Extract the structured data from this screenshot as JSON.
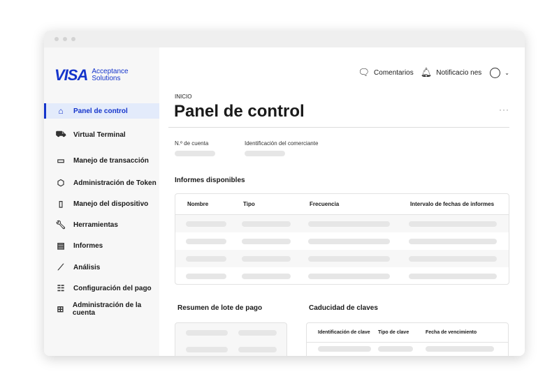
{
  "brand": {
    "logo": "VISA",
    "line1": "Acceptance",
    "line2": "Solutions"
  },
  "sidebar": {
    "items": [
      {
        "label": "Panel de control",
        "icon": "home-icon",
        "active": true
      },
      {
        "label": "Virtual Terminal",
        "icon": "cart-icon"
      },
      {
        "label": "Manejo de transacción",
        "icon": "wallet-icon"
      },
      {
        "label": "Administración de Token",
        "icon": "token-icon"
      },
      {
        "label": "Manejo del dispositivo",
        "icon": "device-icon"
      },
      {
        "label": "Herramientas",
        "icon": "wrench-icon"
      },
      {
        "label": "Informes",
        "icon": "report-icon"
      },
      {
        "label": "Análisis",
        "icon": "chart-icon"
      },
      {
        "label": "Configuración del pago",
        "icon": "checklist-icon"
      },
      {
        "label": "Administración de la cuenta",
        "icon": "grid-icon"
      }
    ]
  },
  "header": {
    "comments": "Comentarios",
    "notifications": "Notificacio nes"
  },
  "page": {
    "breadcrumb": "INICIO",
    "title": "Panel de control",
    "account_label": "N.º de cuenta",
    "merchant_label": "Identificación del comerciante"
  },
  "reports": {
    "title": "Informes disponibles",
    "columns": [
      "Nombre",
      "Tipo",
      "Frecuencia",
      "Intervalo de fechas de informes"
    ]
  },
  "batch": {
    "title": "Resumen de lote de pago"
  },
  "keys": {
    "title": "Caducidad de claves",
    "columns": [
      "Identificación de clave",
      "Tipo de clave",
      "Fecha de vencimiento"
    ]
  }
}
